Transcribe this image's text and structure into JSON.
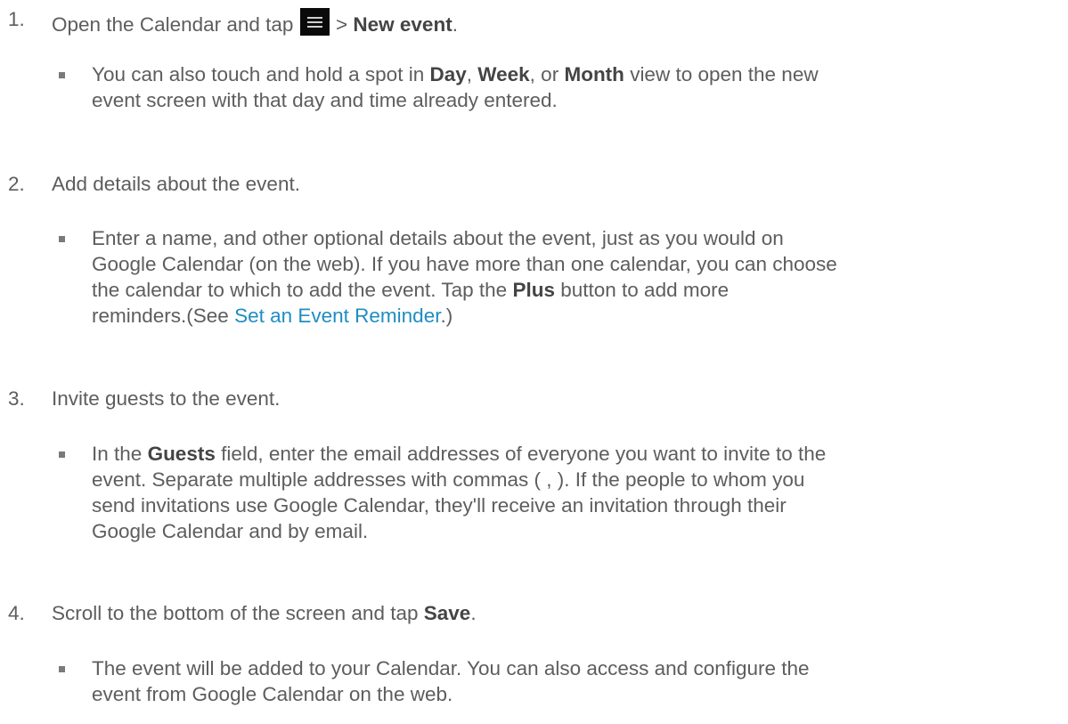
{
  "steps": [
    {
      "number": "1.",
      "text_before": "Open the Calendar and tap",
      "icon": "menu-icon",
      "text_mid": ">",
      "bold": "New event",
      "text_after": ".",
      "sub": {
        "line1_a": "You can also touch and hold a spot in",
        "line1_b1": "Day",
        "line1_c": ",",
        "line1_b2": "Week",
        "line1_d": ", or",
        "line1_b3": "Month",
        "line1_e": "view to open the new",
        "line2": "event screen with that day and time already entered."
      }
    },
    {
      "number": "2.",
      "text": "Add details about the event.",
      "sub": {
        "line1": "Enter a name, and other optional details about the event, just as you would on",
        "line2": "Google Calendar (on the web). If you have more than one calendar, you can choose",
        "line3_a": "the calendar to which to add the event. Tap the",
        "line3_b": "Plus",
        "line3_c": "button to add more",
        "line4_a": "reminders.(See",
        "line4_link": "Set an Event Reminder",
        "line4_c": ".)"
      }
    },
    {
      "number": "3.",
      "text": "Invite guests to the event.",
      "sub": {
        "line1_a": "In the",
        "line1_b": "Guests",
        "line1_c": "field, enter the email addresses of everyone you want to invite to the",
        "line2": "event. Separate multiple addresses with commas ( , ). If the people to whom you",
        "line3": "send invitations use Google Calendar, they'll receive an invitation through their",
        "line4": "Google Calendar and by email."
      }
    },
    {
      "number": "4.",
      "text_before": "Scroll to the bottom of the screen and tap",
      "bold": "Save",
      "text_after": ".",
      "sub": {
        "line1": "The event will be added to your Calendar. You can also access and configure the",
        "line2": "event from Google Calendar on the web."
      }
    }
  ],
  "colors": {
    "text": "#5d5d5d",
    "bold": "#444444",
    "link": "#1f8dc2",
    "icon_bg": "#0a0a0a"
  }
}
